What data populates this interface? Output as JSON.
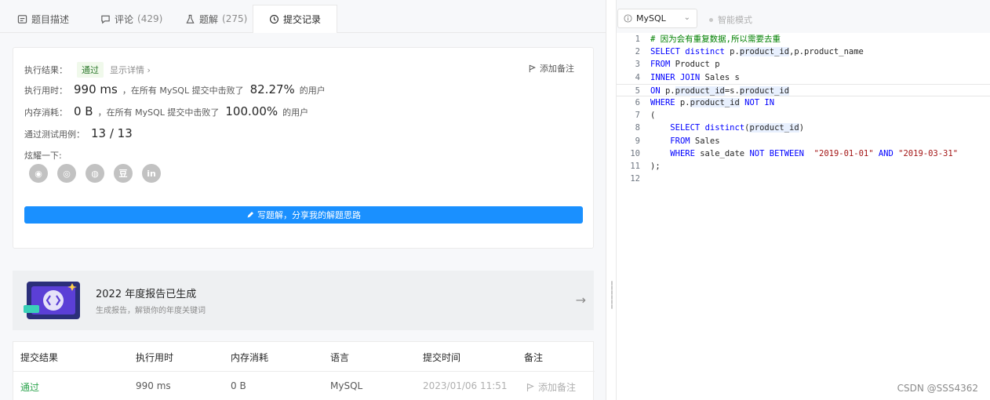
{
  "tabs": [
    {
      "label": "题目描述",
      "count": "",
      "icon": "document-icon"
    },
    {
      "label": "评论",
      "count": "(429)",
      "icon": "comment-icon"
    },
    {
      "label": "题解",
      "count": "(275)",
      "icon": "flask-icon"
    },
    {
      "label": "提交记录",
      "count": "",
      "icon": "clock-icon"
    }
  ],
  "result": {
    "result_label": "执行结果：",
    "status": "通过",
    "detail_link": "显示详情 ›",
    "add_note": "添加备注",
    "runtime_label": "执行用时：",
    "runtime_value": "990 ms",
    "runtime_text": "，在所有 MySQL 提交中击败了",
    "runtime_pct": "82.27%",
    "runtime_tail": "的用户",
    "memory_label": "内存消耗：",
    "memory_value": "0 B",
    "memory_text": "，在所有 MySQL 提交中击败了",
    "memory_pct": "100.00%",
    "memory_tail": "的用户",
    "tests_label": "通过测试用例：",
    "tests_value": "13 / 13",
    "share_label": "炫耀一下:",
    "share_icons": [
      "wechat-icon",
      "weibo-icon",
      "qq-icon",
      "douban-icon",
      "linkedin-icon"
    ],
    "share_glyphs": [
      "◉",
      "◎",
      "◍",
      "豆",
      "in"
    ],
    "write_button": "写题解，分享我的解题思路"
  },
  "banner": {
    "title": "2022 年度报告已生成",
    "subtitle": "生成报告，解锁你的年度关键词"
  },
  "table": {
    "headers": [
      "提交结果",
      "执行用时",
      "内存消耗",
      "语言",
      "提交时间",
      "备注"
    ],
    "row": {
      "result": "通过",
      "runtime": "990 ms",
      "memory": "0 B",
      "language": "MySQL",
      "time": "2023/01/06 11:51",
      "note": "添加备注"
    }
  },
  "editor": {
    "language": "MySQL",
    "smart_mode": "智能模式",
    "line_numbers": [
      "1",
      "2",
      "3",
      "4",
      "5",
      "6",
      "7",
      "8",
      "9",
      "10",
      "11",
      "12"
    ],
    "lines": [
      "# 因为会有重复数据,所以需要去重",
      "SELECT distinct p.product_id,p.product_name",
      "FROM Product p",
      "INNER JOIN Sales s",
      "ON p.product_id=s.product_id",
      "WHERE p.product_id NOT IN",
      "(",
      "    SELECT distinct(product_id)",
      "    FROM Sales",
      "    WHERE sale_date NOT BETWEEN  \"2019-01-01\" AND \"2019-03-31\"",
      ");",
      ""
    ]
  },
  "watermark": "CSDN @SSS4362",
  "colors": {
    "accent": "#1a90ff",
    "success": "#2da44e",
    "keyword": "#0000ff",
    "string": "#a31515",
    "comment": "#008000"
  }
}
